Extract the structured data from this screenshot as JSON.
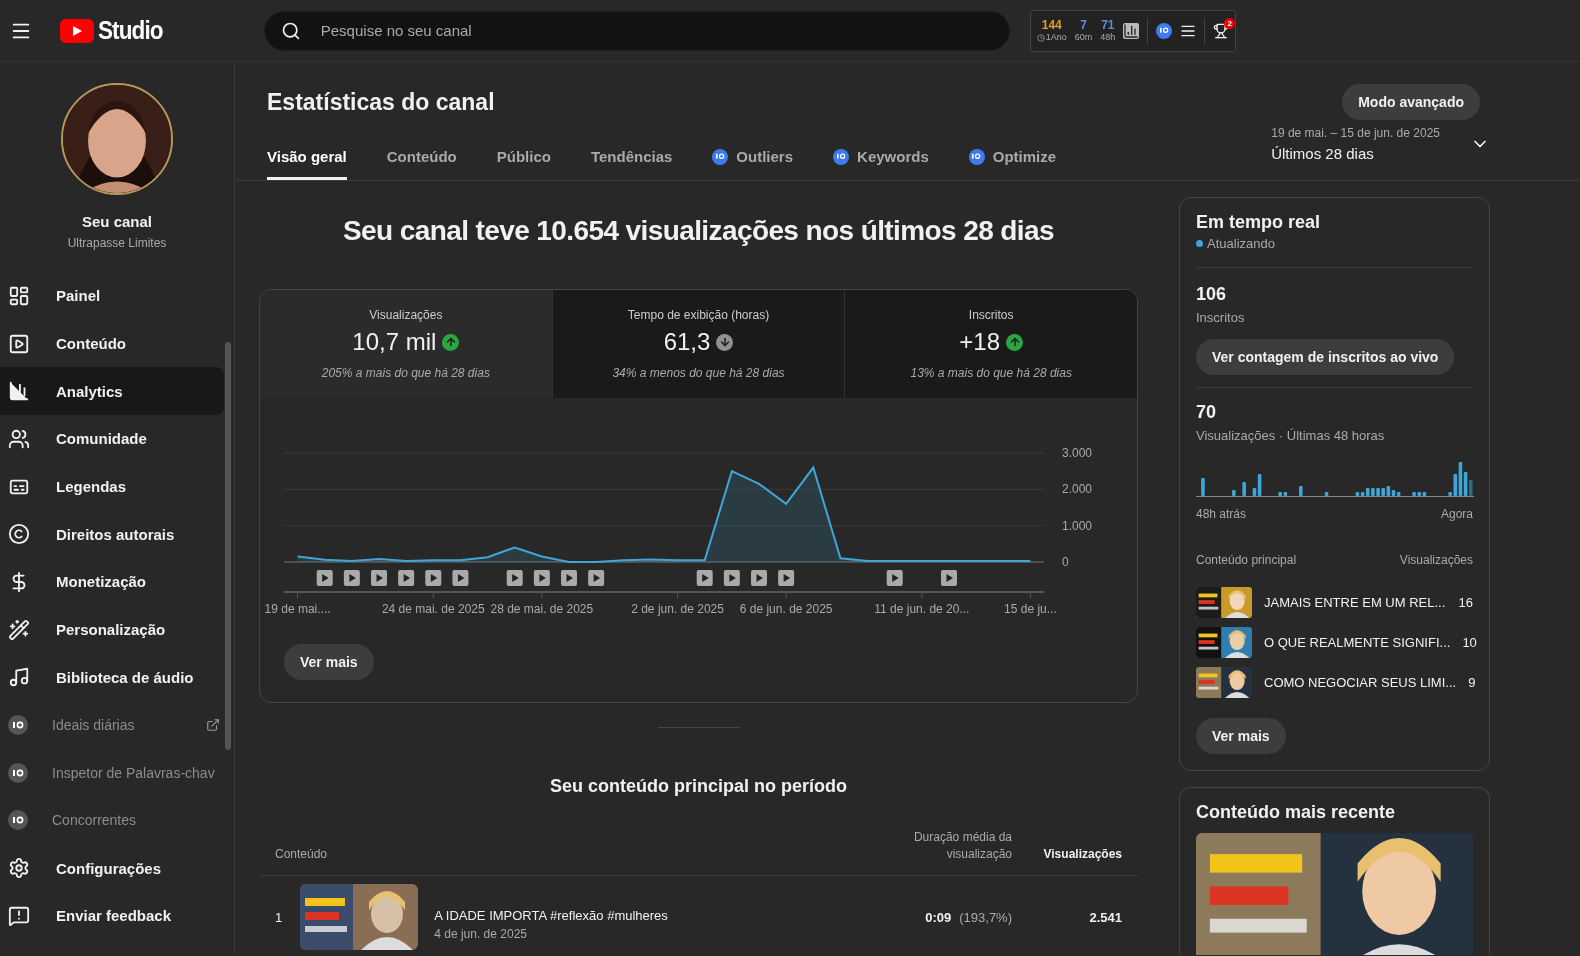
{
  "header": {
    "logo_text": "Studio",
    "search": {
      "placeholder": "Pesquise no seu canal"
    },
    "extension_stats": [
      {
        "value": "144",
        "label": "1Ano",
        "color": "#e0a020"
      },
      {
        "value": "7",
        "label": "60m",
        "color": "#5b8fd9"
      },
      {
        "value": "71",
        "label": "48h",
        "color": "#5b8fd9"
      }
    ],
    "notification_badge": "2"
  },
  "channel": {
    "name": "Seu canal",
    "handle": "Ultrapasse Limites"
  },
  "sidebar": {
    "items": [
      {
        "label": "Painel",
        "kind": "nav",
        "selected": false,
        "external": false
      },
      {
        "label": "Conteúdo",
        "kind": "nav",
        "selected": false,
        "external": false
      },
      {
        "label": "Analytics",
        "kind": "nav",
        "selected": true,
        "external": false
      },
      {
        "label": "Comunidade",
        "kind": "nav",
        "selected": false,
        "external": false
      },
      {
        "label": "Legendas",
        "kind": "nav",
        "selected": false,
        "external": false
      },
      {
        "label": "Direitos autorais",
        "kind": "nav",
        "selected": false,
        "external": false
      },
      {
        "label": "Monetização",
        "kind": "nav",
        "selected": false,
        "external": false
      },
      {
        "label": "Personalização",
        "kind": "nav",
        "selected": false,
        "external": false
      },
      {
        "label": "Biblioteca de áudio",
        "kind": "nav",
        "selected": false,
        "external": false
      },
      {
        "label": "Ideais diárias",
        "kind": "extension",
        "selected": false,
        "external": true
      },
      {
        "label": "Inspetor de Palavras-chav",
        "kind": "extension",
        "selected": false,
        "external": false
      },
      {
        "label": "Concorrentes",
        "kind": "extension",
        "selected": false,
        "external": false
      }
    ],
    "footer_items": [
      {
        "label": "Configurações"
      },
      {
        "label": "Enviar feedback"
      }
    ]
  },
  "page": {
    "title": "Estatísticas do canal",
    "advanced_button": "Modo avançado",
    "tabs": [
      {
        "label": "Visão geral",
        "kind": "native",
        "selected": true
      },
      {
        "label": "Conteúdo",
        "kind": "native",
        "selected": false
      },
      {
        "label": "Público",
        "kind": "native",
        "selected": false
      },
      {
        "label": "Tendências",
        "kind": "native",
        "selected": false
      },
      {
        "label": "Outliers",
        "kind": "extension",
        "selected": false
      },
      {
        "label": "Keywords",
        "kind": "extension",
        "selected": false
      },
      {
        "label": "Optimize",
        "kind": "extension",
        "selected": false
      }
    ],
    "date_range": {
      "range": "19 de mai. – 15 de jun. de 2025",
      "period": "Últimos 28 dias"
    }
  },
  "overview": {
    "headline": "Seu canal teve 10.654 visualizações nos últimos 28 dias",
    "metrics": [
      {
        "label": "Visualizações",
        "value": "10,7 mil",
        "increased": true,
        "comparison": "205% a mais do que há 28 dias",
        "selected": true
      },
      {
        "label": "Tempo de exibição (horas)",
        "value": "61,3",
        "increased": false,
        "comparison": "34% a menos do que há 28 dias",
        "selected": false
      },
      {
        "label": "Inscritos",
        "value": "+18",
        "increased": true,
        "comparison": "13% a mais do que há 28 dias",
        "selected": false
      }
    ],
    "chart_data": {
      "type": "area",
      "categories": [
        "19 de mai....",
        null,
        null,
        null,
        null,
        "24 de mai. de 2025",
        null,
        null,
        null,
        "28 de mai. de 2025",
        null,
        null,
        null,
        null,
        "2 de jun. de 2025",
        null,
        null,
        null,
        "6 de jun. de 2025",
        null,
        null,
        null,
        null,
        "11 de jun. de 20...",
        null,
        null,
        null,
        "15 de ju..."
      ],
      "series": [
        {
          "color": "#3ea6d8",
          "values": [
            150,
            60,
            30,
            80,
            30,
            50,
            50,
            130,
            400,
            150,
            0,
            0,
            50,
            70,
            50,
            50,
            2500,
            2150,
            1600,
            2600,
            100,
            30,
            30,
            30,
            30,
            30,
            30,
            30
          ]
        }
      ],
      "ylim": [
        0,
        3000
      ],
      "yticks": [
        {
          "value": 0,
          "label": "0"
        },
        {
          "value": 1000,
          "label": "1.000"
        },
        {
          "value": 2000,
          "label": "2.000"
        },
        {
          "value": 3000,
          "label": "3.000"
        }
      ]
    },
    "more_button": "Ver mais"
  },
  "top_content": {
    "title": "Seu conteúdo principal no período",
    "columns": [
      {
        "label": "Conteúdo",
        "sorted": false
      },
      {
        "label": "Duração média da visualização",
        "sorted": false
      },
      {
        "label": "Visualizações",
        "sorted": true
      }
    ],
    "rows": [
      {
        "rank": "1",
        "title": "A IDADE IMPORTA #reflexão #mulheres",
        "date": "4 de jun. de 2025",
        "avg_duration": "0:09",
        "avg_percent": "(193,7%)",
        "views": "2.541"
      }
    ]
  },
  "realtime": {
    "title": "Em tempo real",
    "status": "Atualizando",
    "subscribers": {
      "value": "106",
      "label": "Inscritos"
    },
    "live_button": "Ver contagem de inscritos ao vivo",
    "views": {
      "value": "70",
      "label": "Visualizações · Últimas 48 horas"
    },
    "axis_start": "48h atrás",
    "axis_end": "Agora",
    "list_header": {
      "content": "Conteúdo principal",
      "views": "Visualizações"
    },
    "items": [
      {
        "title": "JAMAIS ENTRE EM UM REL...",
        "views": "16"
      },
      {
        "title": "O QUE REALMENTE SIGNIFI...",
        "views": "10"
      },
      {
        "title": "COMO NEGOCIAR SEUS LIMI...",
        "views": "9"
      }
    ],
    "more_button": "Ver mais"
  },
  "latest": {
    "title": "Conteúdo mais recente"
  }
}
